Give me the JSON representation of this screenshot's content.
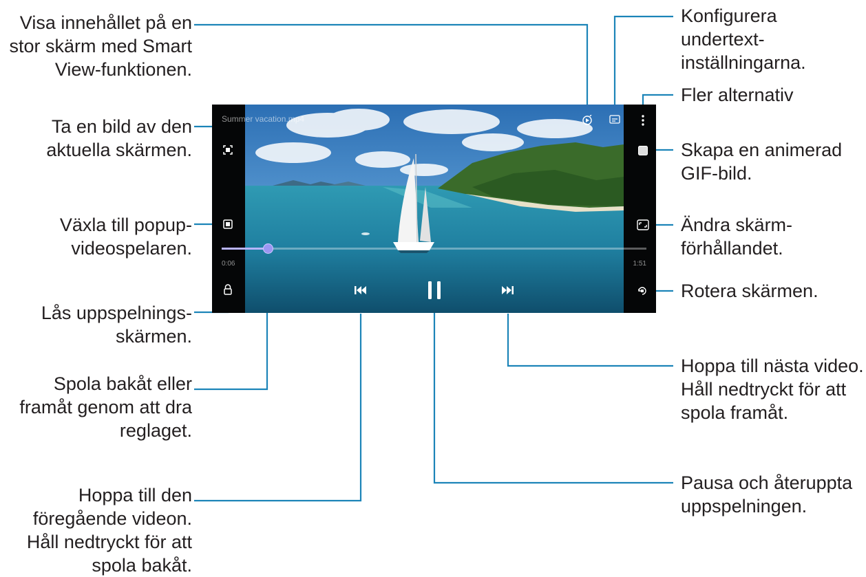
{
  "labels": {
    "smart_view": "Visa innehållet på en\nstor skärm med Smart\nView-funktionen.",
    "capture": "Ta en bild av den\naktuella skärmen.",
    "popup": "Växla till popup-\nvideospelaren.",
    "lock": "Lås uppspelnings-\nskärmen.",
    "seek": "Spola bakåt eller\nframåt genom att dra\nreglaget.",
    "previous": "Hoppa till den\nföregående videon.\nHåll nedtryckt för att\nspola bakåt.",
    "subtitles": "Konfigurera\nundertext-\ninställningarna.",
    "more": "Fler alternativ",
    "gif": "Skapa en animerad\nGIF-bild.",
    "ratio": "Ändra skärm-\nförhållandet.",
    "rotate": "Rotera skärmen.",
    "next": "Hoppa till nästa video.\nHåll nedtryckt för att\nspola framåt.",
    "pause": "Pausa och återuppta\nuppspelningen."
  },
  "player": {
    "title": "Summer vacation.mp4",
    "elapsed": "0:06",
    "duration": "1:51",
    "progress_fraction": 0.11
  },
  "colors": {
    "callout_line": "#1b84b8",
    "label_text": "#231f20",
    "seek_thumb": "#9c97f2"
  },
  "icons": {
    "capture": "capture-icon",
    "popup": "popup-player-icon",
    "lock": "lock-icon",
    "smart_view": "smart-view-icon",
    "subtitles": "subtitles-icon",
    "more": "more-options-icon",
    "gif": "gif-icon",
    "ratio": "aspect-ratio-icon",
    "rotate": "rotate-icon",
    "previous": "skip-previous-icon",
    "pause": "pause-icon",
    "next": "skip-next-icon"
  }
}
